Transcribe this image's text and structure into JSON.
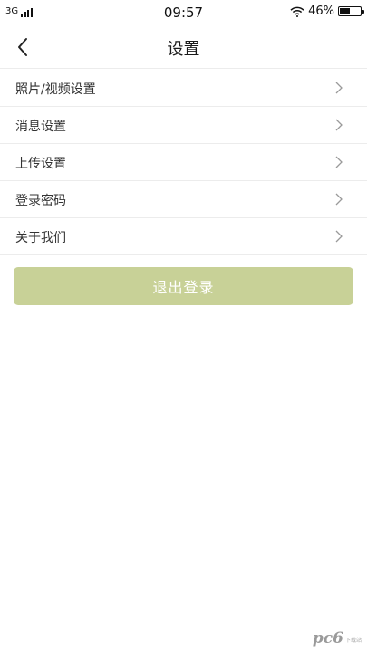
{
  "status_bar": {
    "network": "3G",
    "time": "09:57",
    "battery_percent": "46%",
    "battery_level": 0.46,
    "wifi_icon": "wifi-icon",
    "signal_icon": "signal-bars-icon",
    "battery_icon": "battery-icon"
  },
  "nav": {
    "title": "设置",
    "back_icon": "chevron-left-icon"
  },
  "settings": {
    "items": [
      {
        "label": "照片/视频设置"
      },
      {
        "label": "消息设置"
      },
      {
        "label": "上传设置"
      },
      {
        "label": "登录密码"
      },
      {
        "label": "关于我们"
      }
    ],
    "chevron_icon": "chevron-right-icon"
  },
  "logout": {
    "label": "退出登录",
    "color": "#c8d197"
  },
  "watermark": {
    "text": "pc6",
    "sub": "下载站"
  }
}
